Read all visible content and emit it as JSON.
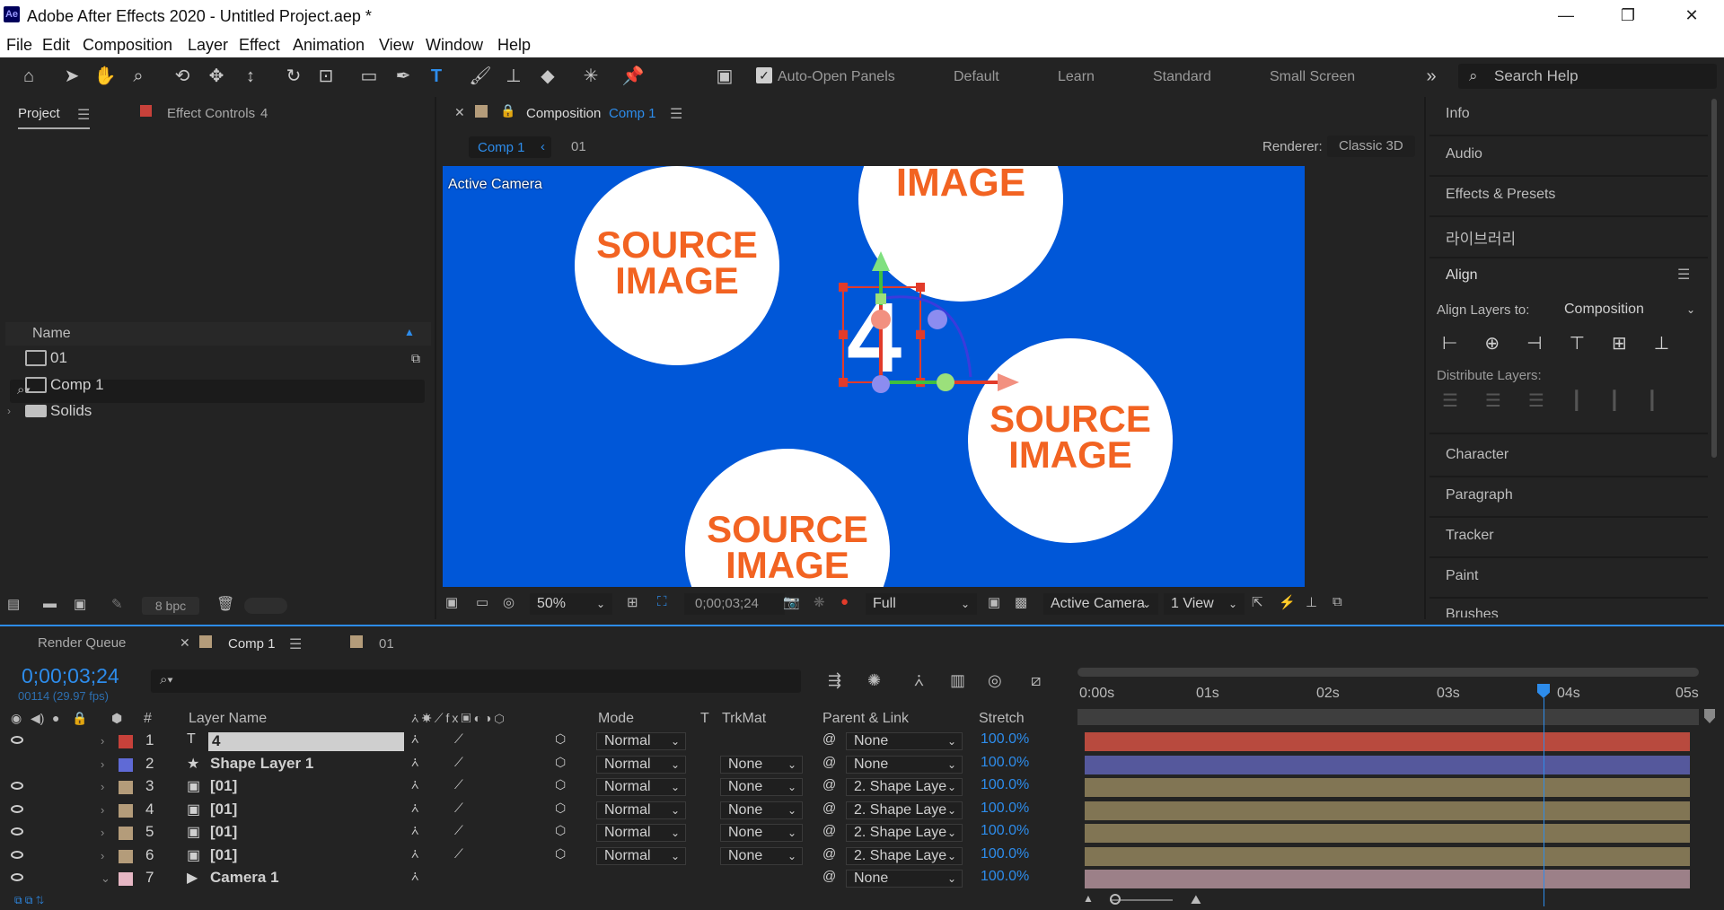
{
  "window": {
    "title": "Adobe After Effects 2020 - Untitled Project.aep *",
    "logo": "Ae"
  },
  "menu": [
    "File",
    "Edit",
    "Composition",
    "Layer",
    "Effect",
    "Animation",
    "View",
    "Window",
    "Help"
  ],
  "toolbar": {
    "auto_open_label": "Auto-Open Panels",
    "workspaces": [
      "Default",
      "Learn",
      "Standard",
      "Small Screen"
    ],
    "search_placeholder": "Search Help"
  },
  "project_panel": {
    "tab_project": "Project",
    "tab_effect_controls": "Effect Controls",
    "effect_controls_target": "4",
    "column_name": "Name",
    "items": [
      "01",
      "Comp 1",
      "Solids"
    ],
    "bpc": "8 bpc"
  },
  "composition_panel": {
    "tab_label": "Composition",
    "comp_name": "Comp 1",
    "breadcrumb": [
      "Comp 1",
      "01"
    ],
    "renderer_label": "Renderer:",
    "renderer_value": "Classic 3D",
    "active_camera_label": "Active Camera",
    "source_image_top": "IMAGE",
    "source_line1": "SOURCE",
    "source_line2": "IMAGE",
    "layer_number": "4",
    "zoom": "50%",
    "timecode": "0;00;03;24",
    "resolution": "Full",
    "view_camera": "Active Camera",
    "view_layout": "1 View"
  },
  "right_panel": {
    "items_top": [
      "Info",
      "Audio",
      "Effects & Presets",
      "라이브러리"
    ],
    "align_title": "Align",
    "align_layers_to_label": "Align Layers to:",
    "align_layers_to_value": "Composition",
    "distribute_label": "Distribute Layers:",
    "items_bottom": [
      "Character",
      "Paragraph",
      "Tracker",
      "Paint",
      "Brushes"
    ]
  },
  "timeline": {
    "tabs": [
      "Render Queue",
      "Comp 1",
      "01"
    ],
    "timecode": "0;00;03;24",
    "frame_info": "00114 (29.97 fps)",
    "columns": {
      "num": "#",
      "layer_name": "Layer Name",
      "mode": "Mode",
      "t": "T",
      "trkmat": "TrkMat",
      "parent": "Parent & Link",
      "stretch": "Stretch"
    },
    "ruler": [
      "0:00s",
      "01s",
      "02s",
      "03s",
      "04s",
      "05s"
    ],
    "playhead_fraction": 0.76,
    "layers": [
      {
        "num": "1",
        "type": "T",
        "name": "4",
        "mode": "Normal",
        "trkmat": "",
        "parent": "None",
        "stretch": "100.0%",
        "color": "#c7413a",
        "bar": "#b84a3e"
      },
      {
        "num": "2",
        "type": "★",
        "name": "Shape Layer 1",
        "mode": "Normal",
        "trkmat": "None",
        "parent": "None",
        "stretch": "100.0%",
        "color": "#5f6ad6",
        "bar": "#55589c"
      },
      {
        "num": "3",
        "type": "▣",
        "name": "[01]",
        "mode": "Normal",
        "trkmat": "None",
        "parent": "2. Shape Laye",
        "stretch": "100.0%",
        "color": "#b49c7a",
        "bar": "#817554"
      },
      {
        "num": "4",
        "type": "▣",
        "name": "[01]",
        "mode": "Normal",
        "trkmat": "None",
        "parent": "2. Shape Laye",
        "stretch": "100.0%",
        "color": "#b49c7a",
        "bar": "#817554"
      },
      {
        "num": "5",
        "type": "▣",
        "name": "[01]",
        "mode": "Normal",
        "trkmat": "None",
        "parent": "2. Shape Laye",
        "stretch": "100.0%",
        "color": "#b49c7a",
        "bar": "#817554"
      },
      {
        "num": "6",
        "type": "▣",
        "name": "[01]",
        "mode": "Normal",
        "trkmat": "None",
        "parent": "2. Shape Laye",
        "stretch": "100.0%",
        "color": "#b49c7a",
        "bar": "#817554"
      },
      {
        "num": "7",
        "type": "▶",
        "name": "Camera 1",
        "mode": "",
        "trkmat": "",
        "parent": "None",
        "stretch": "100.0%",
        "color": "#e6b7c4",
        "bar": "#9c8088"
      }
    ]
  },
  "colors": {
    "accent": "#2d8ceb",
    "viewer_bg": "#0057d8",
    "source_text": "#f26322"
  }
}
